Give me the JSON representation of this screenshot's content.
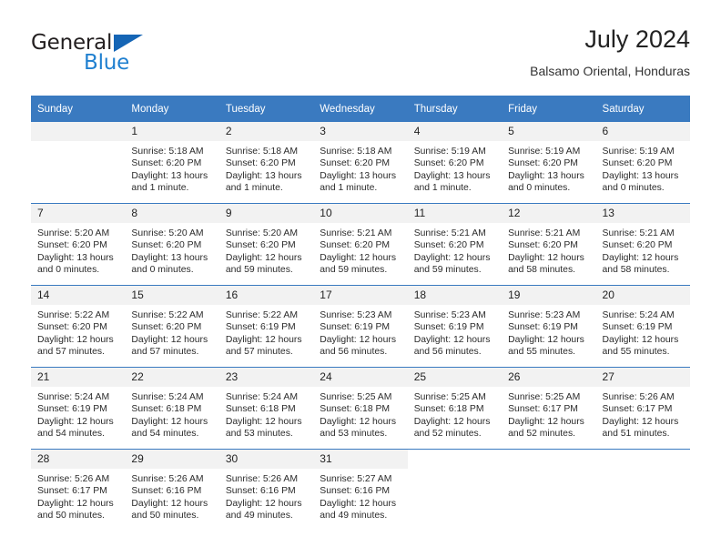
{
  "brand": {
    "name_dark": "General",
    "name_blue": "Blue",
    "accent_blue": "#2080d0",
    "triangle_blue": "#1565b5"
  },
  "header": {
    "month_title": "July 2024",
    "location": "Balsamo Oriental, Honduras"
  },
  "theme": {
    "header_row_bg": "#3a7ac0",
    "daynum_bg": "#f2f2f2",
    "text": "#222222"
  },
  "weekday_headers": [
    "Sunday",
    "Monday",
    "Tuesday",
    "Wednesday",
    "Thursday",
    "Friday",
    "Saturday"
  ],
  "weeks": [
    [
      {
        "day": "",
        "sunrise": "",
        "sunset": "",
        "daylight_line1": "",
        "daylight_line2": "",
        "empty": true
      },
      {
        "day": "1",
        "sunrise": "Sunrise: 5:18 AM",
        "sunset": "Sunset: 6:20 PM",
        "daylight_line1": "Daylight: 13 hours",
        "daylight_line2": "and 1 minute."
      },
      {
        "day": "2",
        "sunrise": "Sunrise: 5:18 AM",
        "sunset": "Sunset: 6:20 PM",
        "daylight_line1": "Daylight: 13 hours",
        "daylight_line2": "and 1 minute."
      },
      {
        "day": "3",
        "sunrise": "Sunrise: 5:18 AM",
        "sunset": "Sunset: 6:20 PM",
        "daylight_line1": "Daylight: 13 hours",
        "daylight_line2": "and 1 minute."
      },
      {
        "day": "4",
        "sunrise": "Sunrise: 5:19 AM",
        "sunset": "Sunset: 6:20 PM",
        "daylight_line1": "Daylight: 13 hours",
        "daylight_line2": "and 1 minute."
      },
      {
        "day": "5",
        "sunrise": "Sunrise: 5:19 AM",
        "sunset": "Sunset: 6:20 PM",
        "daylight_line1": "Daylight: 13 hours",
        "daylight_line2": "and 0 minutes."
      },
      {
        "day": "6",
        "sunrise": "Sunrise: 5:19 AM",
        "sunset": "Sunset: 6:20 PM",
        "daylight_line1": "Daylight: 13 hours",
        "daylight_line2": "and 0 minutes."
      }
    ],
    [
      {
        "day": "7",
        "sunrise": "Sunrise: 5:20 AM",
        "sunset": "Sunset: 6:20 PM",
        "daylight_line1": "Daylight: 13 hours",
        "daylight_line2": "and 0 minutes."
      },
      {
        "day": "8",
        "sunrise": "Sunrise: 5:20 AM",
        "sunset": "Sunset: 6:20 PM",
        "daylight_line1": "Daylight: 13 hours",
        "daylight_line2": "and 0 minutes."
      },
      {
        "day": "9",
        "sunrise": "Sunrise: 5:20 AM",
        "sunset": "Sunset: 6:20 PM",
        "daylight_line1": "Daylight: 12 hours",
        "daylight_line2": "and 59 minutes."
      },
      {
        "day": "10",
        "sunrise": "Sunrise: 5:21 AM",
        "sunset": "Sunset: 6:20 PM",
        "daylight_line1": "Daylight: 12 hours",
        "daylight_line2": "and 59 minutes."
      },
      {
        "day": "11",
        "sunrise": "Sunrise: 5:21 AM",
        "sunset": "Sunset: 6:20 PM",
        "daylight_line1": "Daylight: 12 hours",
        "daylight_line2": "and 59 minutes."
      },
      {
        "day": "12",
        "sunrise": "Sunrise: 5:21 AM",
        "sunset": "Sunset: 6:20 PM",
        "daylight_line1": "Daylight: 12 hours",
        "daylight_line2": "and 58 minutes."
      },
      {
        "day": "13",
        "sunrise": "Sunrise: 5:21 AM",
        "sunset": "Sunset: 6:20 PM",
        "daylight_line1": "Daylight: 12 hours",
        "daylight_line2": "and 58 minutes."
      }
    ],
    [
      {
        "day": "14",
        "sunrise": "Sunrise: 5:22 AM",
        "sunset": "Sunset: 6:20 PM",
        "daylight_line1": "Daylight: 12 hours",
        "daylight_line2": "and 57 minutes."
      },
      {
        "day": "15",
        "sunrise": "Sunrise: 5:22 AM",
        "sunset": "Sunset: 6:20 PM",
        "daylight_line1": "Daylight: 12 hours",
        "daylight_line2": "and 57 minutes."
      },
      {
        "day": "16",
        "sunrise": "Sunrise: 5:22 AM",
        "sunset": "Sunset: 6:19 PM",
        "daylight_line1": "Daylight: 12 hours",
        "daylight_line2": "and 57 minutes."
      },
      {
        "day": "17",
        "sunrise": "Sunrise: 5:23 AM",
        "sunset": "Sunset: 6:19 PM",
        "daylight_line1": "Daylight: 12 hours",
        "daylight_line2": "and 56 minutes."
      },
      {
        "day": "18",
        "sunrise": "Sunrise: 5:23 AM",
        "sunset": "Sunset: 6:19 PM",
        "daylight_line1": "Daylight: 12 hours",
        "daylight_line2": "and 56 minutes."
      },
      {
        "day": "19",
        "sunrise": "Sunrise: 5:23 AM",
        "sunset": "Sunset: 6:19 PM",
        "daylight_line1": "Daylight: 12 hours",
        "daylight_line2": "and 55 minutes."
      },
      {
        "day": "20",
        "sunrise": "Sunrise: 5:24 AM",
        "sunset": "Sunset: 6:19 PM",
        "daylight_line1": "Daylight: 12 hours",
        "daylight_line2": "and 55 minutes."
      }
    ],
    [
      {
        "day": "21",
        "sunrise": "Sunrise: 5:24 AM",
        "sunset": "Sunset: 6:19 PM",
        "daylight_line1": "Daylight: 12 hours",
        "daylight_line2": "and 54 minutes."
      },
      {
        "day": "22",
        "sunrise": "Sunrise: 5:24 AM",
        "sunset": "Sunset: 6:18 PM",
        "daylight_line1": "Daylight: 12 hours",
        "daylight_line2": "and 54 minutes."
      },
      {
        "day": "23",
        "sunrise": "Sunrise: 5:24 AM",
        "sunset": "Sunset: 6:18 PM",
        "daylight_line1": "Daylight: 12 hours",
        "daylight_line2": "and 53 minutes."
      },
      {
        "day": "24",
        "sunrise": "Sunrise: 5:25 AM",
        "sunset": "Sunset: 6:18 PM",
        "daylight_line1": "Daylight: 12 hours",
        "daylight_line2": "and 53 minutes."
      },
      {
        "day": "25",
        "sunrise": "Sunrise: 5:25 AM",
        "sunset": "Sunset: 6:18 PM",
        "daylight_line1": "Daylight: 12 hours",
        "daylight_line2": "and 52 minutes."
      },
      {
        "day": "26",
        "sunrise": "Sunrise: 5:25 AM",
        "sunset": "Sunset: 6:17 PM",
        "daylight_line1": "Daylight: 12 hours",
        "daylight_line2": "and 52 minutes."
      },
      {
        "day": "27",
        "sunrise": "Sunrise: 5:26 AM",
        "sunset": "Sunset: 6:17 PM",
        "daylight_line1": "Daylight: 12 hours",
        "daylight_line2": "and 51 minutes."
      }
    ],
    [
      {
        "day": "28",
        "sunrise": "Sunrise: 5:26 AM",
        "sunset": "Sunset: 6:17 PM",
        "daylight_line1": "Daylight: 12 hours",
        "daylight_line2": "and 50 minutes."
      },
      {
        "day": "29",
        "sunrise": "Sunrise: 5:26 AM",
        "sunset": "Sunset: 6:16 PM",
        "daylight_line1": "Daylight: 12 hours",
        "daylight_line2": "and 50 minutes."
      },
      {
        "day": "30",
        "sunrise": "Sunrise: 5:26 AM",
        "sunset": "Sunset: 6:16 PM",
        "daylight_line1": "Daylight: 12 hours",
        "daylight_line2": "and 49 minutes."
      },
      {
        "day": "31",
        "sunrise": "Sunrise: 5:27 AM",
        "sunset": "Sunset: 6:16 PM",
        "daylight_line1": "Daylight: 12 hours",
        "daylight_line2": "and 49 minutes."
      },
      {
        "day": "",
        "sunrise": "",
        "sunset": "",
        "daylight_line1": "",
        "daylight_line2": "",
        "empty": true,
        "blank": true
      },
      {
        "day": "",
        "sunrise": "",
        "sunset": "",
        "daylight_line1": "",
        "daylight_line2": "",
        "empty": true,
        "blank": true
      },
      {
        "day": "",
        "sunrise": "",
        "sunset": "",
        "daylight_line1": "",
        "daylight_line2": "",
        "empty": true,
        "blank": true
      }
    ]
  ]
}
